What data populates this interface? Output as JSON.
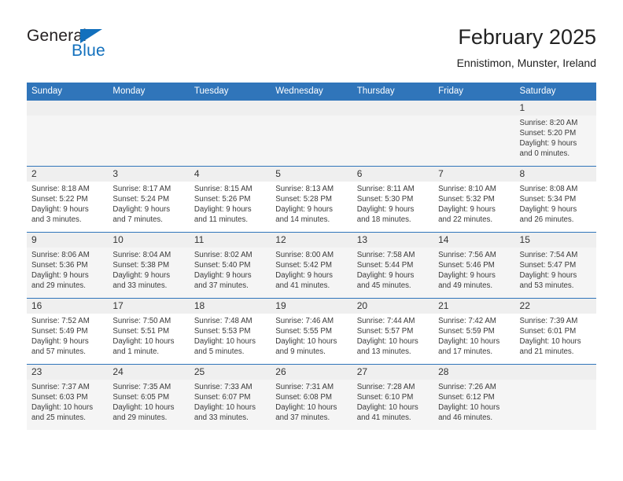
{
  "brand": {
    "name_top": "General",
    "name_bottom": "Blue",
    "triangle_icon": "triangle-icon",
    "color_primary": "#1270bd",
    "color_text": "#231f20"
  },
  "header": {
    "title": "February 2025",
    "subtitle": "Ennistimon, Munster, Ireland"
  },
  "theme": {
    "header_blue": "#3075ba",
    "row_alt_bg": "#f5f5f5",
    "daynum_bg": "#efefef"
  },
  "calendar": {
    "columns": [
      "Sunday",
      "Monday",
      "Tuesday",
      "Wednesday",
      "Thursday",
      "Friday",
      "Saturday"
    ],
    "weeks": [
      [
        {
          "day": "",
          "empty": true
        },
        {
          "day": "",
          "empty": true
        },
        {
          "day": "",
          "empty": true
        },
        {
          "day": "",
          "empty": true
        },
        {
          "day": "",
          "empty": true
        },
        {
          "day": "",
          "empty": true
        },
        {
          "day": "1",
          "sunrise": "Sunrise: 8:20 AM",
          "sunset": "Sunset: 5:20 PM",
          "daylight1": "Daylight: 9 hours",
          "daylight2": "and 0 minutes."
        }
      ],
      [
        {
          "day": "2",
          "sunrise": "Sunrise: 8:18 AM",
          "sunset": "Sunset: 5:22 PM",
          "daylight1": "Daylight: 9 hours",
          "daylight2": "and 3 minutes."
        },
        {
          "day": "3",
          "sunrise": "Sunrise: 8:17 AM",
          "sunset": "Sunset: 5:24 PM",
          "daylight1": "Daylight: 9 hours",
          "daylight2": "and 7 minutes."
        },
        {
          "day": "4",
          "sunrise": "Sunrise: 8:15 AM",
          "sunset": "Sunset: 5:26 PM",
          "daylight1": "Daylight: 9 hours",
          "daylight2": "and 11 minutes."
        },
        {
          "day": "5",
          "sunrise": "Sunrise: 8:13 AM",
          "sunset": "Sunset: 5:28 PM",
          "daylight1": "Daylight: 9 hours",
          "daylight2": "and 14 minutes."
        },
        {
          "day": "6",
          "sunrise": "Sunrise: 8:11 AM",
          "sunset": "Sunset: 5:30 PM",
          "daylight1": "Daylight: 9 hours",
          "daylight2": "and 18 minutes."
        },
        {
          "day": "7",
          "sunrise": "Sunrise: 8:10 AM",
          "sunset": "Sunset: 5:32 PM",
          "daylight1": "Daylight: 9 hours",
          "daylight2": "and 22 minutes."
        },
        {
          "day": "8",
          "sunrise": "Sunrise: 8:08 AM",
          "sunset": "Sunset: 5:34 PM",
          "daylight1": "Daylight: 9 hours",
          "daylight2": "and 26 minutes."
        }
      ],
      [
        {
          "day": "9",
          "sunrise": "Sunrise: 8:06 AM",
          "sunset": "Sunset: 5:36 PM",
          "daylight1": "Daylight: 9 hours",
          "daylight2": "and 29 minutes."
        },
        {
          "day": "10",
          "sunrise": "Sunrise: 8:04 AM",
          "sunset": "Sunset: 5:38 PM",
          "daylight1": "Daylight: 9 hours",
          "daylight2": "and 33 minutes."
        },
        {
          "day": "11",
          "sunrise": "Sunrise: 8:02 AM",
          "sunset": "Sunset: 5:40 PM",
          "daylight1": "Daylight: 9 hours",
          "daylight2": "and 37 minutes."
        },
        {
          "day": "12",
          "sunrise": "Sunrise: 8:00 AM",
          "sunset": "Sunset: 5:42 PM",
          "daylight1": "Daylight: 9 hours",
          "daylight2": "and 41 minutes."
        },
        {
          "day": "13",
          "sunrise": "Sunrise: 7:58 AM",
          "sunset": "Sunset: 5:44 PM",
          "daylight1": "Daylight: 9 hours",
          "daylight2": "and 45 minutes."
        },
        {
          "day": "14",
          "sunrise": "Sunrise: 7:56 AM",
          "sunset": "Sunset: 5:46 PM",
          "daylight1": "Daylight: 9 hours",
          "daylight2": "and 49 minutes."
        },
        {
          "day": "15",
          "sunrise": "Sunrise: 7:54 AM",
          "sunset": "Sunset: 5:47 PM",
          "daylight1": "Daylight: 9 hours",
          "daylight2": "and 53 minutes."
        }
      ],
      [
        {
          "day": "16",
          "sunrise": "Sunrise: 7:52 AM",
          "sunset": "Sunset: 5:49 PM",
          "daylight1": "Daylight: 9 hours",
          "daylight2": "and 57 minutes."
        },
        {
          "day": "17",
          "sunrise": "Sunrise: 7:50 AM",
          "sunset": "Sunset: 5:51 PM",
          "daylight1": "Daylight: 10 hours",
          "daylight2": "and 1 minute."
        },
        {
          "day": "18",
          "sunrise": "Sunrise: 7:48 AM",
          "sunset": "Sunset: 5:53 PM",
          "daylight1": "Daylight: 10 hours",
          "daylight2": "and 5 minutes."
        },
        {
          "day": "19",
          "sunrise": "Sunrise: 7:46 AM",
          "sunset": "Sunset: 5:55 PM",
          "daylight1": "Daylight: 10 hours",
          "daylight2": "and 9 minutes."
        },
        {
          "day": "20",
          "sunrise": "Sunrise: 7:44 AM",
          "sunset": "Sunset: 5:57 PM",
          "daylight1": "Daylight: 10 hours",
          "daylight2": "and 13 minutes."
        },
        {
          "day": "21",
          "sunrise": "Sunrise: 7:42 AM",
          "sunset": "Sunset: 5:59 PM",
          "daylight1": "Daylight: 10 hours",
          "daylight2": "and 17 minutes."
        },
        {
          "day": "22",
          "sunrise": "Sunrise: 7:39 AM",
          "sunset": "Sunset: 6:01 PM",
          "daylight1": "Daylight: 10 hours",
          "daylight2": "and 21 minutes."
        }
      ],
      [
        {
          "day": "23",
          "sunrise": "Sunrise: 7:37 AM",
          "sunset": "Sunset: 6:03 PM",
          "daylight1": "Daylight: 10 hours",
          "daylight2": "and 25 minutes."
        },
        {
          "day": "24",
          "sunrise": "Sunrise: 7:35 AM",
          "sunset": "Sunset: 6:05 PM",
          "daylight1": "Daylight: 10 hours",
          "daylight2": "and 29 minutes."
        },
        {
          "day": "25",
          "sunrise": "Sunrise: 7:33 AM",
          "sunset": "Sunset: 6:07 PM",
          "daylight1": "Daylight: 10 hours",
          "daylight2": "and 33 minutes."
        },
        {
          "day": "26",
          "sunrise": "Sunrise: 7:31 AM",
          "sunset": "Sunset: 6:08 PM",
          "daylight1": "Daylight: 10 hours",
          "daylight2": "and 37 minutes."
        },
        {
          "day": "27",
          "sunrise": "Sunrise: 7:28 AM",
          "sunset": "Sunset: 6:10 PM",
          "daylight1": "Daylight: 10 hours",
          "daylight2": "and 41 minutes."
        },
        {
          "day": "28",
          "sunrise": "Sunrise: 7:26 AM",
          "sunset": "Sunset: 6:12 PM",
          "daylight1": "Daylight: 10 hours",
          "daylight2": "and 46 minutes."
        },
        {
          "day": "",
          "empty": true
        }
      ]
    ]
  }
}
